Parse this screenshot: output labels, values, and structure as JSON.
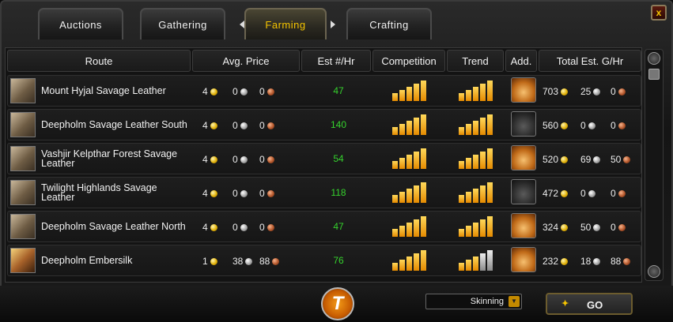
{
  "tabs": {
    "items": [
      {
        "label": "Auctions",
        "active": false
      },
      {
        "label": "Gathering",
        "active": false
      },
      {
        "label": "Farming",
        "active": true
      },
      {
        "label": "Crafting",
        "active": false
      }
    ]
  },
  "close_label": "x",
  "table": {
    "headers": {
      "route": "Route",
      "avg_price": "Avg. Price",
      "rate": "Est #/Hr",
      "competition": "Competition",
      "trend": "Trend",
      "add": "Add.",
      "total": "Total Est. G/Hr"
    },
    "rows": [
      {
        "name": "Mount Hyjal Savage Leather",
        "icon": "savage-leather-icon",
        "avg": {
          "gold": "4",
          "silver": "0",
          "copper": "0"
        },
        "rate": "47",
        "competition_level": 5,
        "trend_level": 5,
        "trend_grey": 0,
        "add_enabled": true,
        "total": {
          "gold": "703",
          "silver": "25",
          "copper": "0"
        }
      },
      {
        "name": "Deepholm Savage Leather South",
        "icon": "savage-leather-icon",
        "avg": {
          "gold": "4",
          "silver": "0",
          "copper": "0"
        },
        "rate": "140",
        "competition_level": 5,
        "trend_level": 5,
        "trend_grey": 0,
        "add_enabled": false,
        "total": {
          "gold": "560",
          "silver": "0",
          "copper": "0"
        }
      },
      {
        "name": "Vashjir Kelpthar Forest Savage Leather",
        "icon": "savage-leather-icon",
        "avg": {
          "gold": "4",
          "silver": "0",
          "copper": "0"
        },
        "rate": "54",
        "competition_level": 5,
        "trend_level": 5,
        "trend_grey": 0,
        "add_enabled": true,
        "total": {
          "gold": "520",
          "silver": "69",
          "copper": "50"
        }
      },
      {
        "name": "Twilight Highlands Savage Leather",
        "icon": "savage-leather-icon",
        "avg": {
          "gold": "4",
          "silver": "0",
          "copper": "0"
        },
        "rate": "118",
        "competition_level": 5,
        "trend_level": 5,
        "trend_grey": 0,
        "add_enabled": false,
        "total": {
          "gold": "472",
          "silver": "0",
          "copper": "0"
        }
      },
      {
        "name": "Deepholm Savage Leather North",
        "icon": "savage-leather-icon",
        "avg": {
          "gold": "4",
          "silver": "0",
          "copper": "0"
        },
        "rate": "47",
        "competition_level": 5,
        "trend_level": 5,
        "trend_grey": 0,
        "add_enabled": true,
        "total": {
          "gold": "324",
          "silver": "50",
          "copper": "0"
        }
      },
      {
        "name": "Deepholm Embersilk",
        "icon": "embersilk-icon",
        "avg": {
          "gold": "1",
          "silver": "38",
          "copper": "88"
        },
        "rate": "76",
        "competition_level": 5,
        "trend_level": 3,
        "trend_grey": 2,
        "add_enabled": true,
        "total": {
          "gold": "232",
          "silver": "18",
          "copper": "88"
        }
      }
    ]
  },
  "footer": {
    "logo_letter": "T",
    "profession": "Skinning",
    "go_label": "GO"
  },
  "colors": {
    "accent": "#f3c300",
    "rate_green": "#35d22d",
    "bar_gold": "#f0a000"
  }
}
